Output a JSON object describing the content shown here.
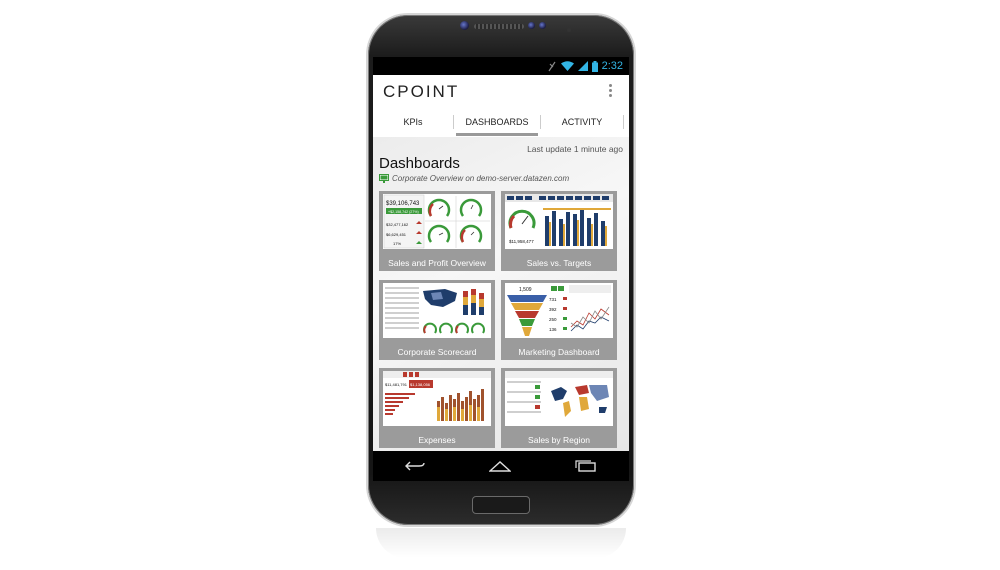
{
  "status_bar": {
    "time": "2:32"
  },
  "app_bar": {
    "title": "CPOINT"
  },
  "tabs": [
    {
      "label": "KPIs",
      "active": false
    },
    {
      "label": "DASHBOARDS",
      "active": true
    },
    {
      "label": "ACTIVITY",
      "active": false
    }
  ],
  "content": {
    "last_update": "Last update 1 minute ago",
    "heading": "Dashboards",
    "server_line": "Corporate Overview on demo-server.datazen.com"
  },
  "dashboards": [
    {
      "label": "Sales and Profit Overview",
      "thumb_text": {
        "revenue": "$39,106,743",
        "badge": "+$2,158,742 (27%)",
        "v1": "$32,477,162",
        "v2": "$6,629,451",
        "pct": "17%"
      }
    },
    {
      "label": "Sales vs. Targets",
      "thumb_text": {
        "value": "$11,958,477"
      }
    },
    {
      "label": "Corporate Scorecard"
    },
    {
      "label": "Marketing Dashboard",
      "thumb_text": {
        "top": "1,509",
        "funnel": [
          "731",
          "392",
          "250",
          "136"
        ]
      }
    },
    {
      "label": "Expenses",
      "thumb_text": {
        "value": "$11,481,791",
        "badge": "$1,138,056"
      }
    },
    {
      "label": "Sales by Region"
    }
  ],
  "colors": {
    "accent": "#33b5e5",
    "tab_indicator": "#999999",
    "card_bg": "#9b9b9b",
    "chart_navy": "#1f3d6b",
    "chart_gold": "#e0a83a",
    "chart_red": "#b8392e",
    "green_badge": "#3a9a3a"
  },
  "icons": {
    "status": [
      "signal-off-icon",
      "wifi-icon",
      "cell-signal-icon",
      "battery-icon"
    ],
    "nav": [
      "back-icon",
      "home-icon",
      "recent-apps-icon"
    ],
    "server": "monitor-icon",
    "menu": "overflow-menu-icon"
  }
}
